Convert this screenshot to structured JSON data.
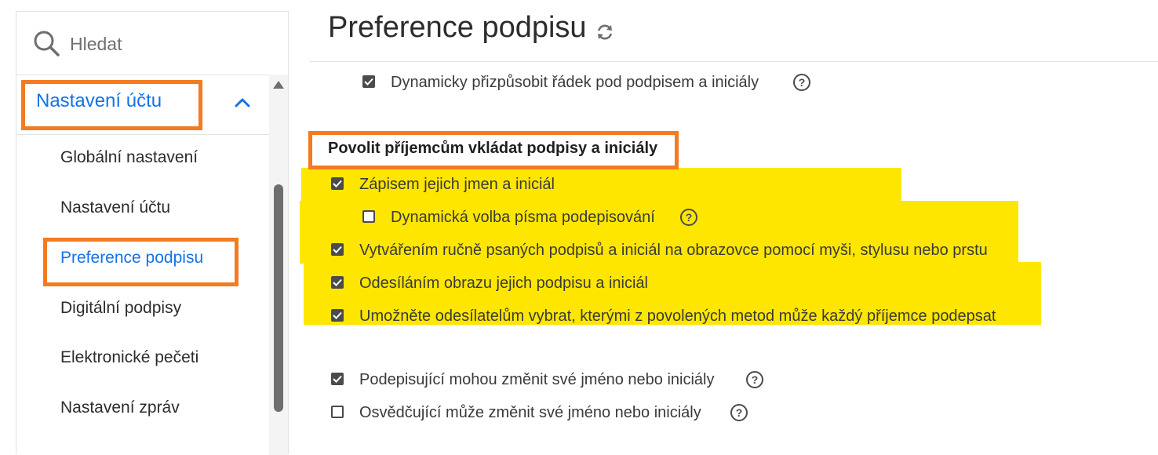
{
  "search": {
    "placeholder": "Hledat"
  },
  "sidebar": {
    "section_label": "Nastavení účtu",
    "items": [
      {
        "label": "Globální nastavení"
      },
      {
        "label": "Nastavení účtu"
      },
      {
        "label": "Preference podpisu",
        "active": true
      },
      {
        "label": "Digitální podpisy"
      },
      {
        "label": "Elektronické pečeti"
      },
      {
        "label": "Nastavení zpráv"
      }
    ]
  },
  "main": {
    "title": "Preference podpisu",
    "dynamic_line_option": {
      "label": "Dynamicky přizpůsobit řádek pod podpisem a iniciály",
      "checked": true
    },
    "recipients_section": {
      "title": "Povolit příjemcům vkládat podpisy a iniciály",
      "options": [
        {
          "label": "Zápisem jejich jmen a iniciál",
          "checked": true
        },
        {
          "label": "Dynamická volba písma podepisování",
          "checked": false
        },
        {
          "label": "Vytvářením ručně psaných podpisů a iniciál na obrazovce pomocí myši, stylusu nebo prstu",
          "checked": true
        },
        {
          "label": "Odesíláním obrazu jejich podpisu a iniciál",
          "checked": true
        },
        {
          "label": "Umožněte odesílatelům vybrat, kterými z povolených metod může každý příjemce podepsat",
          "checked": true
        }
      ]
    },
    "signer_options": [
      {
        "label": "Podepisující mohou změnit své jméno nebo iniciály",
        "checked": true
      },
      {
        "label": "Osvědčující může změnit své jméno nebo iniciály",
        "checked": false
      }
    ]
  },
  "colors": {
    "accent": "#1473e6",
    "highlight": "#ffe600",
    "annotation_border": "#f47b20"
  }
}
